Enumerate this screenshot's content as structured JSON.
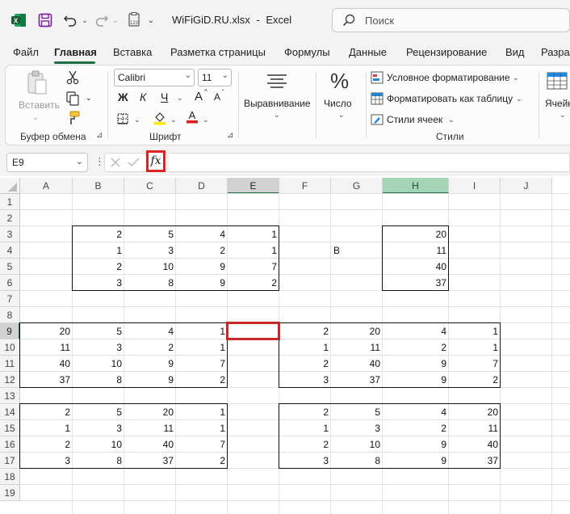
{
  "titlebar": {
    "filename": "WiFiGiD.RU.xlsx",
    "separator": "-",
    "app_name": "Excel",
    "search_placeholder": "Поиск"
  },
  "menu": [
    "Файл",
    "Главная",
    "Вставка",
    "Разметка страницы",
    "Формулы",
    "Данные",
    "Рецензирование",
    "Вид",
    "Разра"
  ],
  "ribbon": {
    "clipboard": {
      "paste_label": "Вставить",
      "group_label": "Буфер обмена"
    },
    "font": {
      "font_name": "Calibri",
      "font_size": "11",
      "bold": "Ж",
      "italic": "К",
      "underline": "Ч",
      "grow": "A",
      "shrink": "A",
      "group_label": "Шрифт"
    },
    "alignment": {
      "label": "Выравнивание"
    },
    "number": {
      "label": "Число",
      "symbol": "%"
    },
    "styles": {
      "conditional": "Условное форматирование",
      "format_table": "Форматировать как таблицу",
      "cell_styles": "Стили ячеек",
      "group_label": "Стили"
    },
    "cells": {
      "label": "Ячейки"
    }
  },
  "formula_bar": {
    "cell_ref": "E9",
    "fx_label": "fx",
    "value": ""
  },
  "grid": {
    "columns": [
      "A",
      "B",
      "C",
      "D",
      "E",
      "F",
      "G",
      "H",
      "I",
      "J"
    ],
    "rows": [
      "1",
      "2",
      "3",
      "4",
      "5",
      "6",
      "7",
      "8",
      "9",
      "10",
      "11",
      "12",
      "13",
      "14",
      "15",
      "16",
      "17",
      "18",
      "19"
    ],
    "selected_cell": "E9",
    "highlighted_column": "H",
    "cells": [
      {
        "col": "B",
        "row": 3,
        "v": "2"
      },
      {
        "col": "C",
        "row": 3,
        "v": "5"
      },
      {
        "col": "D",
        "row": 3,
        "v": "4"
      },
      {
        "col": "E",
        "row": 3,
        "v": "1"
      },
      {
        "col": "B",
        "row": 4,
        "v": "1"
      },
      {
        "col": "C",
        "row": 4,
        "v": "3"
      },
      {
        "col": "D",
        "row": 4,
        "v": "2"
      },
      {
        "col": "E",
        "row": 4,
        "v": "1"
      },
      {
        "col": "B",
        "row": 5,
        "v": "2"
      },
      {
        "col": "C",
        "row": 5,
        "v": "10"
      },
      {
        "col": "D",
        "row": 5,
        "v": "9"
      },
      {
        "col": "E",
        "row": 5,
        "v": "7"
      },
      {
        "col": "B",
        "row": 6,
        "v": "3"
      },
      {
        "col": "C",
        "row": 6,
        "v": "8"
      },
      {
        "col": "D",
        "row": 6,
        "v": "9"
      },
      {
        "col": "E",
        "row": 6,
        "v": "2"
      },
      {
        "col": "H",
        "row": 3,
        "v": "20"
      },
      {
        "col": "H",
        "row": 4,
        "v": "11"
      },
      {
        "col": "H",
        "row": 5,
        "v": "40"
      },
      {
        "col": "H",
        "row": 6,
        "v": "37"
      },
      {
        "col": "G",
        "row": 4,
        "v": "В",
        "text": true
      },
      {
        "col": "A",
        "row": 9,
        "v": "20"
      },
      {
        "col": "B",
        "row": 9,
        "v": "5"
      },
      {
        "col": "C",
        "row": 9,
        "v": "4"
      },
      {
        "col": "D",
        "row": 9,
        "v": "1"
      },
      {
        "col": "A",
        "row": 10,
        "v": "11"
      },
      {
        "col": "B",
        "row": 10,
        "v": "3"
      },
      {
        "col": "C",
        "row": 10,
        "v": "2"
      },
      {
        "col": "D",
        "row": 10,
        "v": "1"
      },
      {
        "col": "A",
        "row": 11,
        "v": "40"
      },
      {
        "col": "B",
        "row": 11,
        "v": "10"
      },
      {
        "col": "C",
        "row": 11,
        "v": "9"
      },
      {
        "col": "D",
        "row": 11,
        "v": "7"
      },
      {
        "col": "A",
        "row": 12,
        "v": "37"
      },
      {
        "col": "B",
        "row": 12,
        "v": "8"
      },
      {
        "col": "C",
        "row": 12,
        "v": "9"
      },
      {
        "col": "D",
        "row": 12,
        "v": "2"
      },
      {
        "col": "F",
        "row": 9,
        "v": "2"
      },
      {
        "col": "G",
        "row": 9,
        "v": "20"
      },
      {
        "col": "H",
        "row": 9,
        "v": "4"
      },
      {
        "col": "I",
        "row": 9,
        "v": "1"
      },
      {
        "col": "F",
        "row": 10,
        "v": "1"
      },
      {
        "col": "G",
        "row": 10,
        "v": "11"
      },
      {
        "col": "H",
        "row": 10,
        "v": "2"
      },
      {
        "col": "I",
        "row": 10,
        "v": "1"
      },
      {
        "col": "F",
        "row": 11,
        "v": "2"
      },
      {
        "col": "G",
        "row": 11,
        "v": "40"
      },
      {
        "col": "H",
        "row": 11,
        "v": "9"
      },
      {
        "col": "I",
        "row": 11,
        "v": "7"
      },
      {
        "col": "F",
        "row": 12,
        "v": "3"
      },
      {
        "col": "G",
        "row": 12,
        "v": "37"
      },
      {
        "col": "H",
        "row": 12,
        "v": "9"
      },
      {
        "col": "I",
        "row": 12,
        "v": "2"
      },
      {
        "col": "A",
        "row": 14,
        "v": "2"
      },
      {
        "col": "B",
        "row": 14,
        "v": "5"
      },
      {
        "col": "C",
        "row": 14,
        "v": "20"
      },
      {
        "col": "D",
        "row": 14,
        "v": "1"
      },
      {
        "col": "A",
        "row": 15,
        "v": "1"
      },
      {
        "col": "B",
        "row": 15,
        "v": "3"
      },
      {
        "col": "C",
        "row": 15,
        "v": "11"
      },
      {
        "col": "D",
        "row": 15,
        "v": "1"
      },
      {
        "col": "A",
        "row": 16,
        "v": "2"
      },
      {
        "col": "B",
        "row": 16,
        "v": "10"
      },
      {
        "col": "C",
        "row": 16,
        "v": "40"
      },
      {
        "col": "D",
        "row": 16,
        "v": "7"
      },
      {
        "col": "A",
        "row": 17,
        "v": "3"
      },
      {
        "col": "B",
        "row": 17,
        "v": "8"
      },
      {
        "col": "C",
        "row": 17,
        "v": "37"
      },
      {
        "col": "D",
        "row": 17,
        "v": "2"
      },
      {
        "col": "F",
        "row": 14,
        "v": "2"
      },
      {
        "col": "G",
        "row": 14,
        "v": "5"
      },
      {
        "col": "H",
        "row": 14,
        "v": "4"
      },
      {
        "col": "I",
        "row": 14,
        "v": "20"
      },
      {
        "col": "F",
        "row": 15,
        "v": "1"
      },
      {
        "col": "G",
        "row": 15,
        "v": "3"
      },
      {
        "col": "H",
        "row": 15,
        "v": "2"
      },
      {
        "col": "I",
        "row": 15,
        "v": "11"
      },
      {
        "col": "F",
        "row": 16,
        "v": "2"
      },
      {
        "col": "G",
        "row": 16,
        "v": "10"
      },
      {
        "col": "H",
        "row": 16,
        "v": "9"
      },
      {
        "col": "I",
        "row": 16,
        "v": "40"
      },
      {
        "col": "F",
        "row": 17,
        "v": "3"
      },
      {
        "col": "G",
        "row": 17,
        "v": "8"
      },
      {
        "col": "H",
        "row": 17,
        "v": "9"
      },
      {
        "col": "I",
        "row": 17,
        "v": "37"
      }
    ],
    "boxes": [
      {
        "from": "B3",
        "to": "E6"
      },
      {
        "from": "H3",
        "to": "H6"
      },
      {
        "from": "A9",
        "to": "D12"
      },
      {
        "from": "F9",
        "to": "I12"
      },
      {
        "from": "A14",
        "to": "D17"
      },
      {
        "from": "F14",
        "to": "I17"
      }
    ]
  },
  "colors": {
    "accent": "#1e7145",
    "selection": "#c62828"
  }
}
